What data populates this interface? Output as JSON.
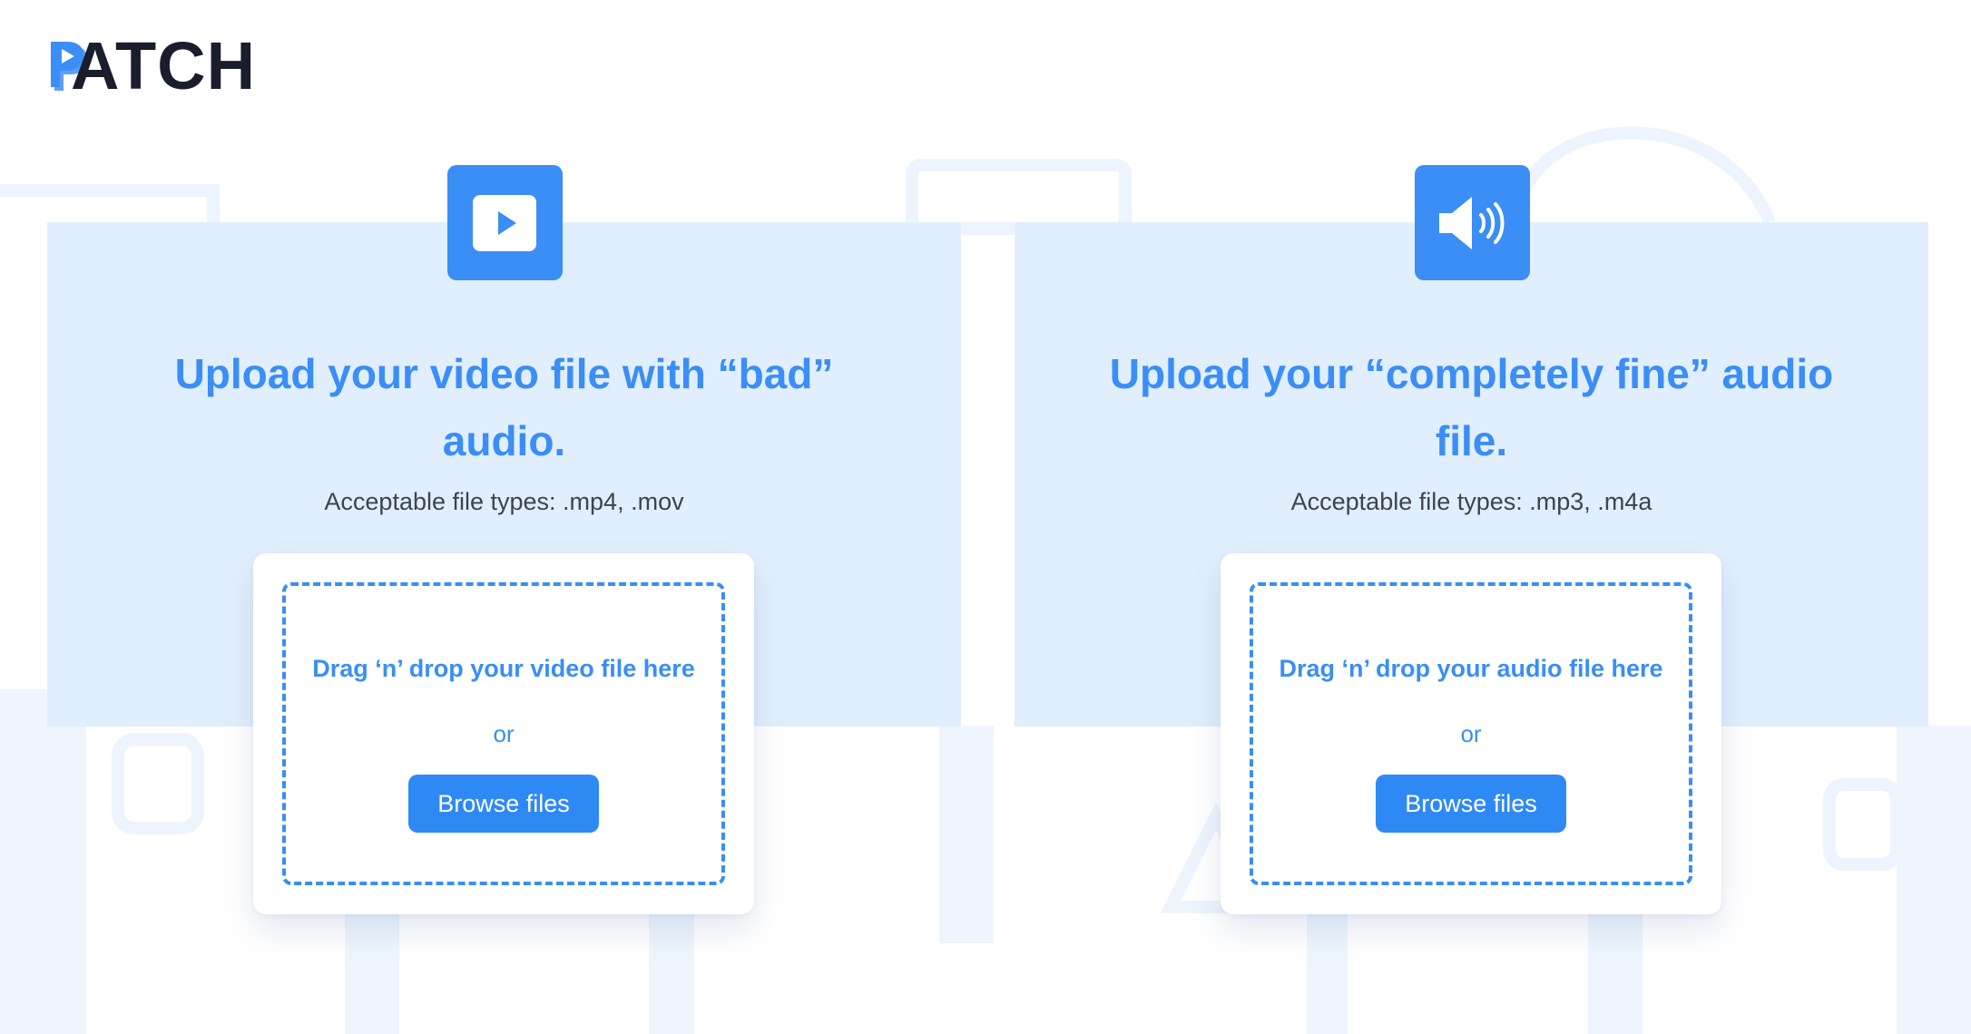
{
  "brand": {
    "logo_text": "ATCH",
    "logo_letter": "P"
  },
  "colors": {
    "accent": "#3a8ef5",
    "panel_bg": "#e1eefd",
    "text_dark": "#1a1d2b"
  },
  "video_upload": {
    "icon": "play-icon",
    "title": "Upload your video file with “bad” audio.",
    "file_types": "Acceptable file types: .mp4, .mov",
    "dropzone_text": "Drag ‘n’ drop your video file here",
    "or_text": "or",
    "browse_label": "Browse files"
  },
  "audio_upload": {
    "icon": "speaker-icon",
    "title": "Upload your “completely fine” audio file.",
    "file_types": "Acceptable file types: .mp3, .m4a",
    "dropzone_text": "Drag ‘n’ drop your audio file here",
    "or_text": "or",
    "browse_label": "Browse files"
  }
}
